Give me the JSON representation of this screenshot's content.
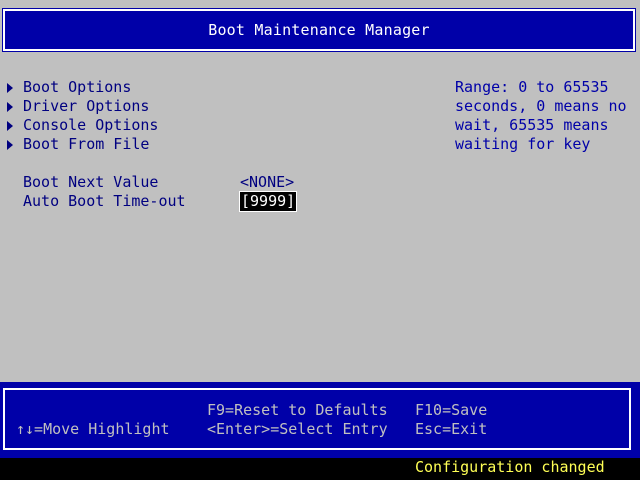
{
  "header": {
    "title": "Boot Maintenance Manager"
  },
  "menu": {
    "items": [
      {
        "label": "Boot Options"
      },
      {
        "label": "Driver Options"
      },
      {
        "label": "Console Options"
      },
      {
        "label": "Boot From File"
      }
    ]
  },
  "fields": [
    {
      "label": "Boot Next Value",
      "value": "<NONE>"
    },
    {
      "label": "Auto Boot Time-out",
      "value": "[9999]"
    }
  ],
  "help": {
    "lines": [
      "Range: 0 to 65535",
      "seconds, 0 means no",
      "wait, 65535 means",
      "waiting for key"
    ]
  },
  "footer": {
    "move_highlight": "↑↓=Move Highlight",
    "reset_defaults": "F9=Reset to Defaults",
    "select_entry": "<Enter>=Select Entry",
    "save": "F10=Save",
    "exit": "Esc=Exit"
  },
  "status": {
    "text": "Configuration changed"
  },
  "colors": {
    "background": "#c0c0c0",
    "accent_blue": "#0000a8",
    "text_blue": "#000080",
    "status_yellow": "#ffff55"
  }
}
